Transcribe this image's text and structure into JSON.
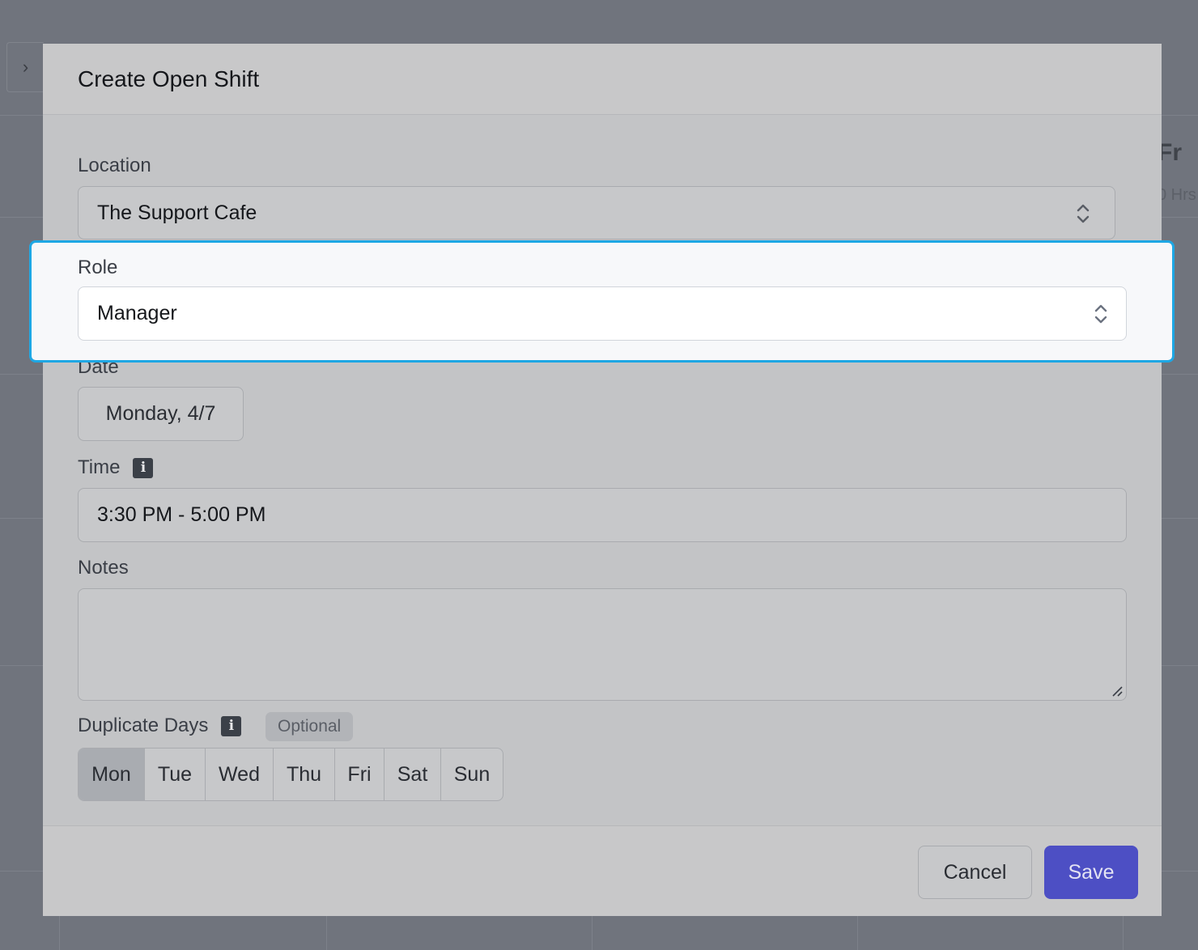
{
  "background": {
    "day_header": "Fr",
    "hours_text": "0 Hrs"
  },
  "modal": {
    "title": "Create Open Shift",
    "location": {
      "label": "Location",
      "value": "The Support Cafe"
    },
    "role": {
      "label": "Role",
      "value": "Manager"
    },
    "date": {
      "label": "Date",
      "value": "Monday, 4/7"
    },
    "time": {
      "label": "Time",
      "value": "3:30 PM - 5:00 PM"
    },
    "notes": {
      "label": "Notes",
      "value": ""
    },
    "duplicate_days": {
      "label": "Duplicate Days",
      "badge": "Optional",
      "days": [
        "Mon",
        "Tue",
        "Wed",
        "Thu",
        "Fri",
        "Sat",
        "Sun"
      ],
      "selected": "Mon"
    },
    "footer": {
      "cancel_label": "Cancel",
      "save_label": "Save"
    }
  },
  "colors": {
    "accent": "#4d4fc4",
    "highlight_border": "#1ea7e4"
  },
  "icons": {
    "sidebar_toggle": "chevron-right-icon",
    "select": "chevron-up-down-icon",
    "info": "info-icon",
    "resize": "resize-grip-icon"
  }
}
